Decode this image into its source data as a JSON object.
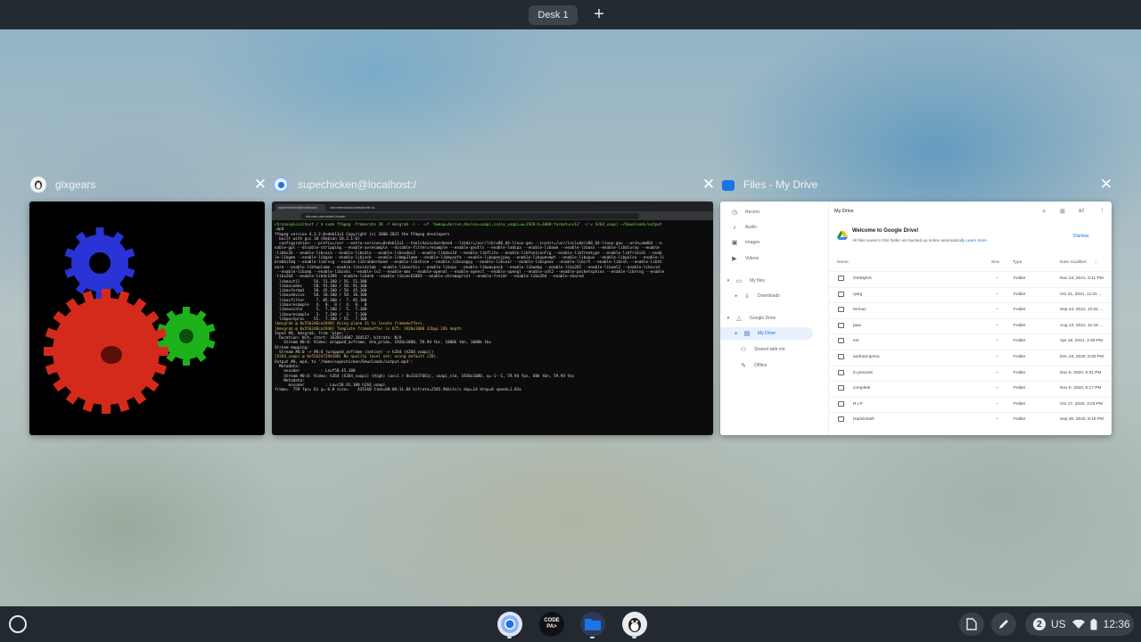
{
  "desk_bar": {
    "desk_label": "Desk 1",
    "add_desk_label": "+"
  },
  "windows": [
    {
      "title": "glxgears",
      "close": "✕"
    },
    {
      "title": "supechicken@localhost:/",
      "close": "✕"
    },
    {
      "title": "Files - My Drive",
      "close": "✕"
    }
  ],
  "terminal": {
    "tabs": [
      "supechicken@localhost:/",
      "chromebook/automake/lib ui..."
    ],
    "url": "chrome-untrusted://crosh",
    "lines": [
      "chronos@localhost / $ sudo ffmpeg -framerate 30 -f kmsgrab -i - -vf 'hwmap=derive_device=vaapi,scale_vaapi=w=1920:h=1080:format=nv12' -c:v h264_vaapi ~/Downloads/output",
      ".mp4",
      "ffmpeg version 4.3.2-0+deb11u1 Copyright (c) 2000-2021 the FFmpeg developers",
      "  built with gcc 10 (Debian 10.2.1-6)",
      "  configuration: --prefix=/usr --extra-version=0+deb11u1 --toolchain=hardened --libdir=/usr/lib/x86_64-linux-gnu --incdir=/usr/include/x86_64-linux-gnu --arch=amd64 --e",
      "nable-gpl --disable-stripping --enable-avresample --disable-filter=resample --enable-gnutls --enable-ladspa --enable-libaom --enable-libass --enable-libbluray --enable",
      "-libbs2b --enable-libcaca --enable-libcdio --enable-libcodec2 --enable-libdav1d --enable-libflite --enable-libfontconfig --enable-libfreetype --enable-libfribidi --enab",
      "le-libgme --enable-libgsm --enable-libjack --enable-libmp3lame --enable-libmysofa --enable-libopenjpeg --enable-libopenmpt --enable-libopus --enable-libpulse --enable-li",
      "brabbitmq --enable-librsvg --enable-librubberband --enable-libshine --enable-libsnappy --enable-libsoxr --enable-libspeex --enable-libsrt --enable-libssh --enable-libth",
      "eora --enable-libtwolame --enable-libvidstab --enable-libvorbis --enable-libvpx --enable-libwavpack --enable-libwebp --enable-libx265 --enable-libxml2 --enable-libxvid",
      " --enable-libzmq --enable-libzvbi --enable-lv2 --enable-omx --enable-openal --enable-opencl --enable-opengl --enable-sdl2 --enable-pocketsphinx --enable-librsvg --enable",
      "-libx264 --enable-libdc1394 --enable-libdrm --enable-libiec61883 --enable-chromaprint --enable-frei0r --enable-libx264 --enable-shared",
      "  libavutil      56. 51.100 / 56. 51.100",
      "  libavcodec     58. 91.100 / 58. 91.100",
      "  libavformat    58. 45.100 / 58. 45.100",
      "  libavdevice    58. 10.100 / 58. 10.100",
      "  libavfilter     7. 85.100 /  7. 85.100",
      "  libavresample   4.  0.  0 /  4.  0.  0",
      "  libswscale      5.  7.100 /  5.  7.100",
      "  libswresample   3.  7.100 /  3.  7.100",
      "  libpostproc    55.  7.100 / 55.  7.100",
      "[kmsgrab @ 0x55b2d6ca1940] Using plane 31 to locate framebuffers.",
      "[kmsgrab @ 0x55b2d6ca1940] Template framebuffer is 675: 1920x1080 32bpp 24b depth",
      "Input #0, kmsgrab, from 'pipe:':",
      "  Duration: N/A, start: 1639154087.184527, bitrate: N/A",
      "    Stream #0:0: Video: wrapped_avframe, drm_prime, 1920x1080, 59.94 tbr, 1000k tbn, 1000k tbc",
      "Stream mapping:",
      "  Stream #0:0 -> #0:0 (wrapped_avframe (native) -> h264 (h264_vaapi))",
      "[h264_vaapi @ 0x55b2d7294100] No quality level set; using default (20).",
      "Output #0, mp4, to '/home/supechicken/Downloads/output.mp4':",
      "  Metadata:",
      "    encoder         : Lavf58.45.100",
      "    Stream #0:0: Video: h264 (h264_vaapi) (High) (avc1 / 0x31637661), vaapi_vld, 1920x1080, q=-1--1, 59.94 fps, 60k tbn, 59.94 tbc",
      "    Metadata:",
      "      encoder         : Lavc58.91.100 h264_vaapi",
      "frame=  759 fps= 61 q=-0.0 size=    4352kB time=00:00:11.84 bitrate=2585.9kbits/s dup=14 drop=0 speed=1.03x"
    ]
  },
  "files_app": {
    "sidebar": [
      {
        "label": "Recent",
        "icon": "clock-icon"
      },
      {
        "label": "Audio",
        "icon": "audio-icon"
      },
      {
        "label": "Images",
        "icon": "image-icon"
      },
      {
        "label": "Videos",
        "icon": "video-icon"
      },
      {
        "label": "My files",
        "icon": "laptop-icon"
      },
      {
        "label": "Downloads",
        "icon": "download-icon"
      },
      {
        "label": "Google Drive",
        "icon": "drive-icon"
      },
      {
        "label": "My Drive",
        "icon": "drive-folder-icon"
      },
      {
        "label": "Shared with me",
        "icon": "people-icon"
      },
      {
        "label": "Offline",
        "icon": "pin-icon"
      }
    ],
    "header_title": "My Drive",
    "sort_label": "AZ",
    "banner_title": "Welcome to Google Drive!",
    "banner_text": "All files saved in this folder are backed up online automatically",
    "banner_link": "Learn more",
    "dismiss_label": "Dismiss",
    "columns": {
      "name": "Name",
      "size": "Size",
      "type": "Type",
      "date": "Date modified"
    },
    "rows": [
      {
        "name": "GetMyDS",
        "size": "--",
        "type": "Folder",
        "date": "Nov 24, 2021, 6:11 PM"
      },
      {
        "name": "cpkg",
        "size": "--",
        "type": "Folder",
        "date": "Oct 31, 2021, 11:01 ..."
      },
      {
        "name": "termux",
        "size": "--",
        "type": "Folder",
        "date": "Sep 24, 2021, 10:41 ..."
      },
      {
        "name": "pwa",
        "size": "--",
        "type": "Folder",
        "date": "Aug 13, 2021, 11:18 ..."
      },
      {
        "name": "ext",
        "size": "--",
        "type": "Folder",
        "date": "Apr 16, 2021, 4:49 PM"
      },
      {
        "name": "android-qemu",
        "size": "--",
        "type": "Folder",
        "date": "Dec 23, 2020, 5:05 PM"
      },
      {
        "name": "in process",
        "size": "--",
        "type": "Folder",
        "date": "Nov 8, 2020, 6:31 PM"
      },
      {
        "name": "complete",
        "size": "--",
        "type": "Folder",
        "date": "Nov 8, 2020, 6:17 PM"
      },
      {
        "name": "R.I.P",
        "size": "--",
        "type": "Folder",
        "date": "Oct 17, 2020, 3:03 PM"
      },
      {
        "name": "Hackintosh",
        "size": "--",
        "type": "Folder",
        "date": "Sep 30, 2020, 9:19 PM"
      }
    ]
  },
  "shelf": {
    "apps": [
      {
        "name": "Chrome",
        "icon": "chrome-icon"
      },
      {
        "name": "Code PAX",
        "icon": "code-pax-icon",
        "label": "CODE PA>"
      },
      {
        "name": "Files",
        "icon": "files-icon"
      },
      {
        "name": "Linux apps",
        "icon": "penguin-icon"
      }
    ],
    "notification_count": "2",
    "keyboard_layout": "US",
    "time": "12:36"
  },
  "colors": {
    "shelf": "#232931",
    "accent": "#1a73e8",
    "gear_red": "#d42a1c",
    "gear_green": "#1db21b",
    "gear_blue": "#2a33d6"
  }
}
